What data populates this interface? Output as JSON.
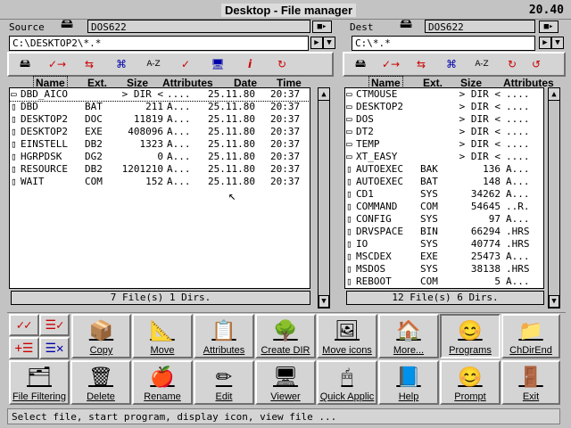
{
  "window": {
    "title": "Desktop - File manager",
    "clock": "20.40"
  },
  "left": {
    "label": "Source",
    "drive": "DOS622",
    "path": "C:\\DESKTOP2\\*.*",
    "columns": [
      "Name",
      "Ext.",
      "Size",
      "Attributes",
      "Date",
      "Time"
    ],
    "rows": [
      {
        "name": "DBD_AICO",
        "ext": "",
        "size": "> DIR <",
        "attr": "....",
        "date": "25.11.80",
        "time": "20:37"
      },
      {
        "name": "DBD",
        "ext": "BAT",
        "size": "211",
        "attr": "A...",
        "date": "25.11.80",
        "time": "20:37"
      },
      {
        "name": "DESKTOP2",
        "ext": "DOC",
        "size": "11819",
        "attr": "A...",
        "date": "25.11.80",
        "time": "20:37"
      },
      {
        "name": "DESKTOP2",
        "ext": "EXE",
        "size": "408096",
        "attr": "A...",
        "date": "25.11.80",
        "time": "20:37"
      },
      {
        "name": "EINSTELL",
        "ext": "DB2",
        "size": "1323",
        "attr": "A...",
        "date": "25.11.80",
        "time": "20:37"
      },
      {
        "name": "HGRPDSK",
        "ext": "DG2",
        "size": "0",
        "attr": "A...",
        "date": "25.11.80",
        "time": "20:37"
      },
      {
        "name": "RESOURCE",
        "ext": "DB2",
        "size": "1201210",
        "attr": "A...",
        "date": "25.11.80",
        "time": "20:37"
      },
      {
        "name": "WAIT",
        "ext": "COM",
        "size": "152",
        "attr": "A...",
        "date": "25.11.80",
        "time": "20:37"
      }
    ],
    "status": "7 File(s) 1 Dirs."
  },
  "right": {
    "label": "Dest",
    "drive": "DOS622",
    "path": "C:\\*.*",
    "columns": [
      "Name",
      "Ext.",
      "Size",
      "Attributes"
    ],
    "rows": [
      {
        "name": "CTMOUSE",
        "ext": "",
        "size": "> DIR <",
        "attr": "...."
      },
      {
        "name": "DESKTOP2",
        "ext": "",
        "size": "> DIR <",
        "attr": "...."
      },
      {
        "name": "DOS",
        "ext": "",
        "size": "> DIR <",
        "attr": "...."
      },
      {
        "name": "DT2",
        "ext": "",
        "size": "> DIR <",
        "attr": "...."
      },
      {
        "name": "TEMP",
        "ext": "",
        "size": "> DIR <",
        "attr": "...."
      },
      {
        "name": "XT_EASY",
        "ext": "",
        "size": "> DIR <",
        "attr": "...."
      },
      {
        "name": "AUTOEXEC",
        "ext": "BAK",
        "size": "136",
        "attr": "A..."
      },
      {
        "name": "AUTOEXEC",
        "ext": "BAT",
        "size": "148",
        "attr": "A..."
      },
      {
        "name": "CD1",
        "ext": "SYS",
        "size": "34262",
        "attr": "A..."
      },
      {
        "name": "COMMAND",
        "ext": "COM",
        "size": "54645",
        "attr": "..R."
      },
      {
        "name": "CONFIG",
        "ext": "SYS",
        "size": "97",
        "attr": "A..."
      },
      {
        "name": "DRVSPACE",
        "ext": "BIN",
        "size": "66294",
        "attr": ".HRS"
      },
      {
        "name": "IO",
        "ext": "SYS",
        "size": "40774",
        "attr": ".HRS"
      },
      {
        "name": "MSCDEX",
        "ext": "EXE",
        "size": "25473",
        "attr": "A..."
      },
      {
        "name": "MSDOS",
        "ext": "SYS",
        "size": "38138",
        "attr": ".HRS"
      },
      {
        "name": "REBOOT",
        "ext": "COM",
        "size": "5",
        "attr": "A..."
      }
    ],
    "status": "12 File(s) 6 Dirs."
  },
  "buttons_row1": [
    {
      "label": "Copy",
      "icon": "copy-icon"
    },
    {
      "label": "Move",
      "icon": "move-icon"
    },
    {
      "label": "Attributes",
      "icon": "attributes-icon"
    },
    {
      "label": "Create DIR",
      "icon": "create-dir-icon"
    },
    {
      "label": "Move icons",
      "icon": "move-icons-icon"
    },
    {
      "label": "More...",
      "icon": "more-icon"
    },
    {
      "label": "Programs",
      "icon": "programs-icon"
    },
    {
      "label": "ChDirEnd",
      "icon": "chdirend-icon"
    }
  ],
  "buttons_row2": [
    {
      "label": "File Filtering",
      "icon": "file-filter-icon"
    },
    {
      "label": "Delete",
      "icon": "delete-icon"
    },
    {
      "label": "Rename",
      "icon": "rename-icon"
    },
    {
      "label": "Edit",
      "icon": "edit-icon"
    },
    {
      "label": "Viewer",
      "icon": "viewer-icon"
    },
    {
      "label": "Quick Applic",
      "icon": "quick-applic-icon"
    },
    {
      "label": "Help",
      "icon": "help-icon"
    },
    {
      "label": "Prompt",
      "icon": "prompt-icon"
    },
    {
      "label": "Exit",
      "icon": "exit-icon"
    }
  ],
  "misc": {
    "cd_label": "CD",
    "dos_label": "Dos",
    "az_label": "A-Z"
  },
  "statusbar": "Select file, start program, display icon, view file ..."
}
